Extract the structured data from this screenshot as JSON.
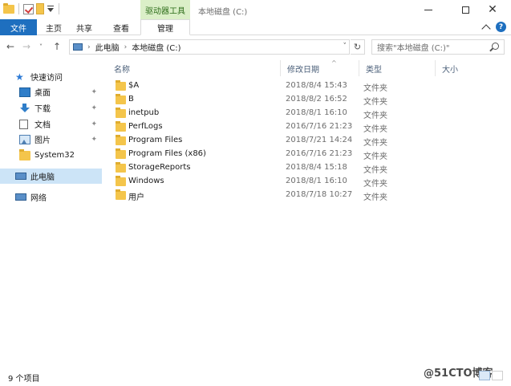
{
  "title_bar": {
    "context_tab": "驱动器工具",
    "window_title": "本地磁盘 (C:)",
    "close_glyph": "✕"
  },
  "ribbon": {
    "tabs": [
      {
        "label": "文件"
      },
      {
        "label": "主页"
      },
      {
        "label": "共享"
      },
      {
        "label": "查看"
      },
      {
        "label": "管理"
      }
    ]
  },
  "address_bar": {
    "crumbs": [
      "此电脑",
      "本地磁盘 (C:)"
    ],
    "search_placeholder": "搜索\"本地磁盘 (C:)\""
  },
  "nav_pane": {
    "items": [
      {
        "label": "快速访问",
        "icon": "star-icon"
      },
      {
        "label": "桌面",
        "icon": "desktop-icon",
        "pinned": true
      },
      {
        "label": "下载",
        "icon": "download-icon",
        "pinned": true
      },
      {
        "label": "文档",
        "icon": "document-icon",
        "pinned": true
      },
      {
        "label": "图片",
        "icon": "pictures-icon",
        "pinned": true
      },
      {
        "label": "System32",
        "icon": "folder-icon"
      },
      {
        "label": "此电脑",
        "icon": "computer-icon",
        "selected": true
      },
      {
        "label": "网络",
        "icon": "network-icon"
      }
    ]
  },
  "file_list": {
    "columns": [
      "名称",
      "修改日期",
      "类型",
      "大小"
    ],
    "rows": [
      {
        "name": "$A",
        "date": "2018/8/4 15:43",
        "type": "文件夹"
      },
      {
        "name": "B",
        "date": "2018/8/2 16:52",
        "type": "文件夹"
      },
      {
        "name": "inetpub",
        "date": "2018/8/1 16:10",
        "type": "文件夹"
      },
      {
        "name": "PerfLogs",
        "date": "2016/7/16 21:23",
        "type": "文件夹"
      },
      {
        "name": "Program Files",
        "date": "2018/7/21 14:24",
        "type": "文件夹"
      },
      {
        "name": "Program Files (x86)",
        "date": "2016/7/16 21:23",
        "type": "文件夹"
      },
      {
        "name": "StorageReports",
        "date": "2018/8/4 15:18",
        "type": "文件夹"
      },
      {
        "name": "Windows",
        "date": "2018/8/1 16:10",
        "type": "文件夹"
      },
      {
        "name": "用户",
        "date": "2018/7/18 10:27",
        "type": "文件夹"
      }
    ]
  },
  "status_bar": {
    "item_count": "9 个项目",
    "watermark": "@51CTO博客"
  },
  "colors": {
    "file_tab": "#1e6fbf",
    "context_tab_bg": "#dbefc8",
    "selected_nav": "#cce4f7",
    "folder": "#f4c54b"
  }
}
